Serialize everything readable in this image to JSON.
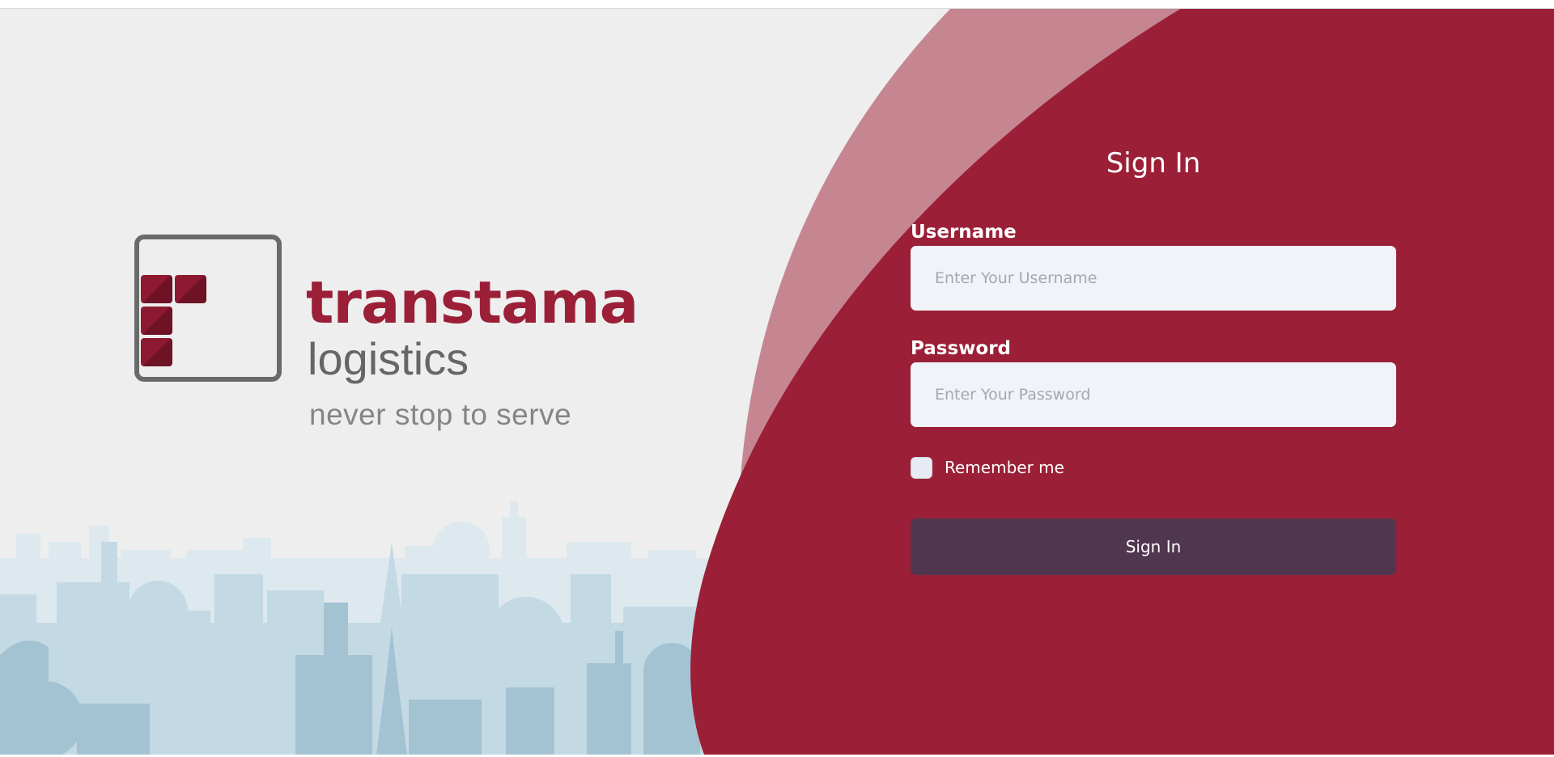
{
  "brand": {
    "name": "transtama",
    "subname": "logistics",
    "tagline": "never stop to serve",
    "colors": {
      "primary": "#9b1f37",
      "wave_light": "#c58692",
      "button": "#51364f",
      "background": "#eeeeee",
      "skyline": "#c3d9e4"
    }
  },
  "form": {
    "title": "Sign In",
    "username": {
      "label": "Username",
      "value": "",
      "placeholder": "Enter Your Username"
    },
    "password": {
      "label": "Password",
      "value": "",
      "placeholder": "Enter Your Password"
    },
    "remember": {
      "label": "Remember me",
      "checked": false
    },
    "submit_label": "Sign In"
  }
}
